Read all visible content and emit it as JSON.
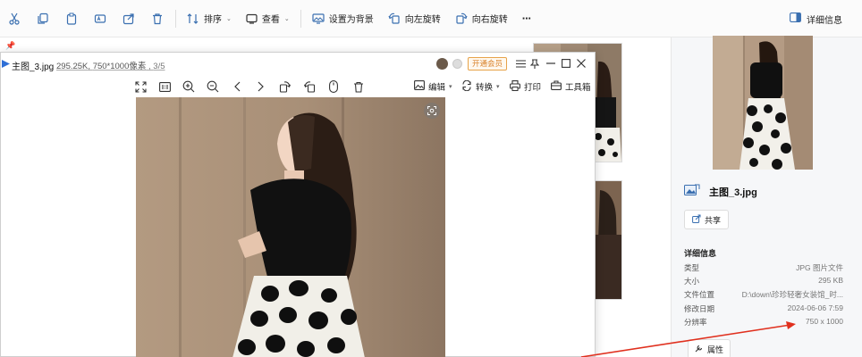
{
  "toolbar": {
    "icons": [
      "cut-icon",
      "copy-icon",
      "paste-icon",
      "rename-icon",
      "share-icon",
      "delete-icon"
    ],
    "sort_label": "排序",
    "view_label": "查看",
    "set_bg_label": "设置为背景",
    "rotate_left_label": "向左旋转",
    "rotate_right_label": "向右旋转",
    "more_label": "···",
    "details_label": "详细信息",
    "accent_color": "#3a6fb0"
  },
  "viewer": {
    "filename": "主图_3.jpg",
    "file_size": "295.25K",
    "dimensions": "750*1000像素",
    "position": "3/5",
    "vip_label": "开通会员",
    "tools": [
      "fullscreen-icon",
      "actual-size-icon",
      "zoom-in-icon",
      "zoom-out-icon",
      "previous-icon",
      "next-icon",
      "rotate-right-icon",
      "rotate-left-icon",
      "mouse-icon",
      "delete-icon"
    ],
    "edit_label": "编辑",
    "convert_label": "转换",
    "print_label": "打印",
    "toolbox_label": "工具箱",
    "vip_color": "#d9822b"
  },
  "details": {
    "filename": "主图_3.jpg",
    "share_label": "共享",
    "section_title": "详细信息",
    "rows": [
      {
        "label": "类型",
        "value": "JPG 图片文件"
      },
      {
        "label": "大小",
        "value": "295 KB"
      },
      {
        "label": "文件位置",
        "value": "D:\\down\\珍珍轻奢女装馆_时..."
      },
      {
        "label": "修改日期",
        "value": "2024-06-06 7:59"
      },
      {
        "label": "分辨率",
        "value": "750 x 1000"
      }
    ],
    "properties_label": "属性"
  },
  "annotation": {
    "arrow_color": "#e0301e"
  }
}
